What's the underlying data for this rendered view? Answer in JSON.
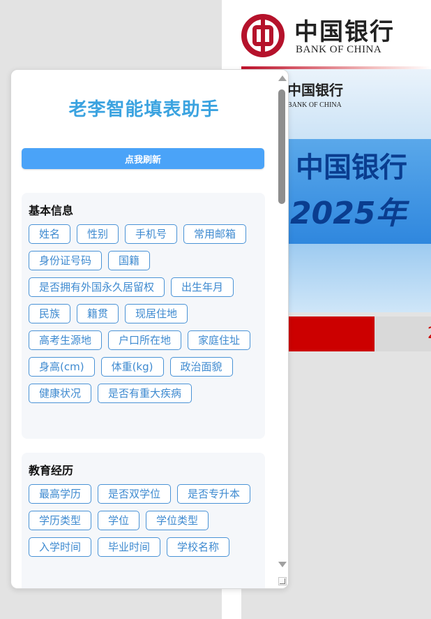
{
  "background_page": {
    "brand_cn": "中国银行",
    "brand_en": "BANK OF CHINA",
    "banner_logo_cn": "中国银行",
    "banner_logo_en": "BANK OF CHINA",
    "banner_title_line1": "中国银行",
    "banner_title_line2": "2025年",
    "tab_partial_text": "2",
    "accent_color": "#cc0000"
  },
  "panel": {
    "title": "老李智能填表助手",
    "refresh_label": "点我刷新",
    "sections": [
      {
        "title": "基本信息",
        "tags": [
          "姓名",
          "性别",
          "手机号",
          "常用邮箱",
          "身份证号码",
          "国籍",
          "是否拥有外国永久居留权",
          "出生年月",
          "民族",
          "籍贯",
          "现居住地",
          "高考生源地",
          "户口所在地",
          "家庭住址",
          "身高(cm)",
          "体重(kg)",
          "政治面貌",
          "健康状况",
          "是否有重大疾病"
        ]
      },
      {
        "title": "教育经历",
        "tags": [
          "最高学历",
          "是否双学位",
          "是否专升本",
          "学历类型",
          "学位",
          "学位类型",
          "入学时间",
          "毕业时间",
          "学校名称"
        ]
      }
    ],
    "title_color": "#3ba3e0",
    "button_color": "#4aa3f8",
    "tag_border_color": "#4a93d6"
  }
}
